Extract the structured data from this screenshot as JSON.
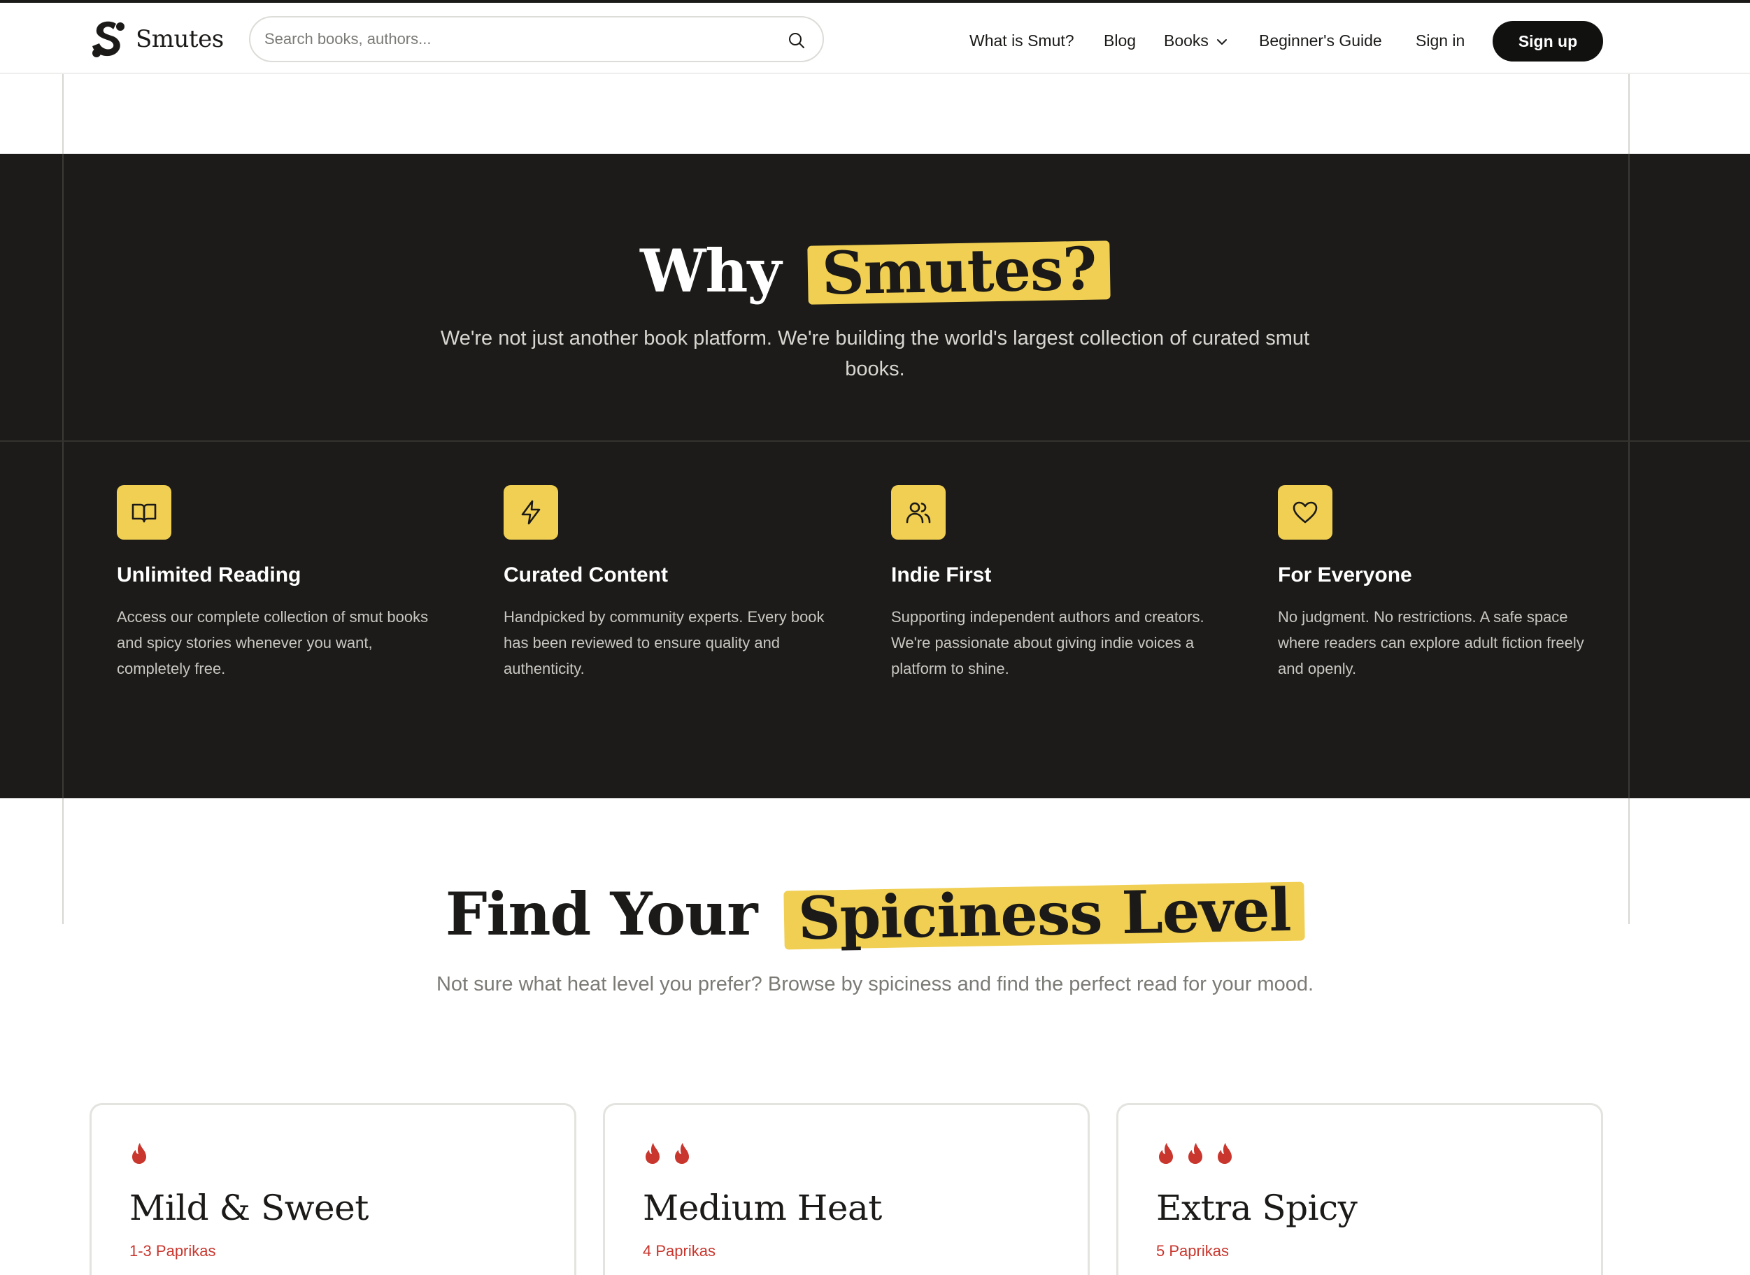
{
  "header": {
    "brand": "Smutes",
    "search_placeholder": "Search books, authors...",
    "nav": {
      "what_is": "What is Smut?",
      "blog": "Blog",
      "books": "Books",
      "guide": "Beginner's Guide",
      "signin": "Sign in",
      "signup": "Sign up"
    }
  },
  "why": {
    "title_plain": "Why",
    "title_highlight": "Smutes?",
    "subtitle": "We're not just another book platform. We're building the world's largest collection of curated smut books.",
    "features": [
      {
        "icon": "book-open-icon",
        "title": "Unlimited Reading",
        "description": "Access our complete collection of smut books and spicy stories whenever you want, completely free."
      },
      {
        "icon": "lightning-icon",
        "title": "Curated Content",
        "description": "Handpicked by community experts. Every book has been reviewed to ensure quality and authenticity."
      },
      {
        "icon": "users-icon",
        "title": "Indie First",
        "description": "Supporting independent authors and creators. We're passionate about giving indie voices a platform to shine."
      },
      {
        "icon": "heart-icon",
        "title": "For Everyone",
        "description": "No judgment. No restrictions. A safe space where readers can explore adult fiction freely and openly."
      }
    ]
  },
  "spice": {
    "title_plain": "Find Your",
    "title_highlight": "Spiciness Level",
    "subtitle": "Not sure what heat level you prefer? Browse by spiciness and find the perfect read for your mood.",
    "cards": [
      {
        "flames": 1,
        "title": "Mild & Sweet",
        "level": "1-3 Paprikas"
      },
      {
        "flames": 2,
        "title": "Medium Heat",
        "level": "4 Paprikas"
      },
      {
        "flames": 3,
        "title": "Extra Spicy",
        "level": "5 Paprikas"
      }
    ]
  },
  "colors": {
    "accent": "#f0cf52",
    "dark_bg": "#1c1b19",
    "flame": "#c9362d"
  }
}
